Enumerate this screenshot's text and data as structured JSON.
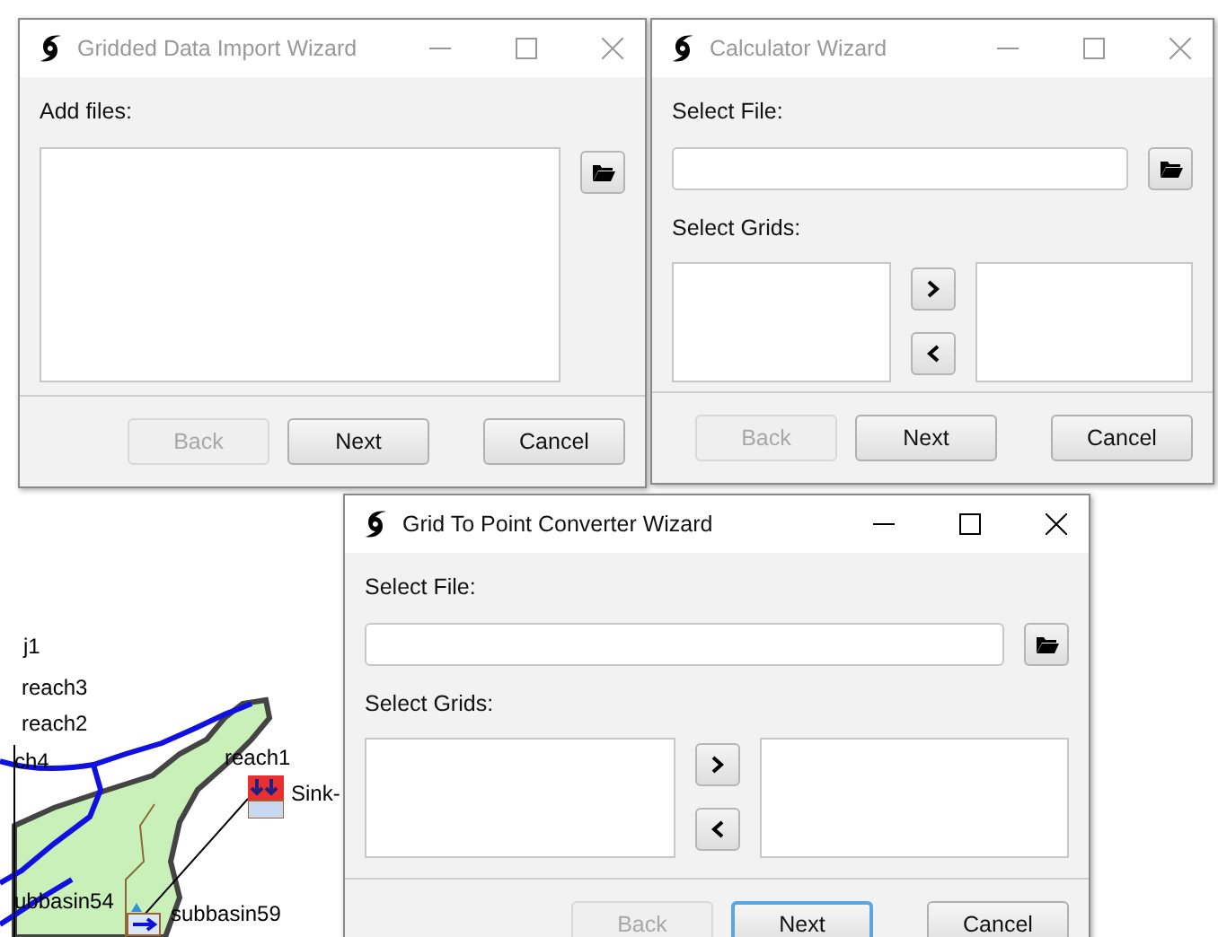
{
  "windows": [
    {
      "kind": "file_list",
      "title": "Gridded Data Import Wizard",
      "active": false,
      "labels": [
        "Add files:"
      ],
      "buttons": [
        {
          "label": "Back",
          "disabled": true,
          "focused": false
        },
        {
          "label": "Next",
          "disabled": false,
          "focused": false
        },
        {
          "label": "Cancel",
          "disabled": false,
          "focused": false
        }
      ]
    },
    {
      "kind": "grid_select",
      "title": "Calculator Wizard",
      "active": false,
      "labels": [
        "Select File:",
        "Select Grids:"
      ],
      "buttons": [
        {
          "label": "Back",
          "disabled": true,
          "focused": false
        },
        {
          "label": "Next",
          "disabled": false,
          "focused": false
        },
        {
          "label": "Cancel",
          "disabled": false,
          "focused": false
        }
      ]
    },
    {
      "kind": "grid_select",
      "title": "Grid To Point Converter Wizard",
      "active": true,
      "labels": [
        "Select File:",
        "Select Grids:"
      ],
      "buttons": [
        {
          "label": "Back",
          "disabled": true,
          "focused": false
        },
        {
          "label": "Next",
          "disabled": false,
          "focused": true
        },
        {
          "label": "Cancel",
          "disabled": false,
          "focused": false
        }
      ]
    }
  ],
  "map": {
    "labels": [
      "j1",
      "reach3",
      "reach2",
      "ch4",
      "reach1",
      "Sink-",
      "ubbasin54",
      "subbasin59"
    ]
  }
}
